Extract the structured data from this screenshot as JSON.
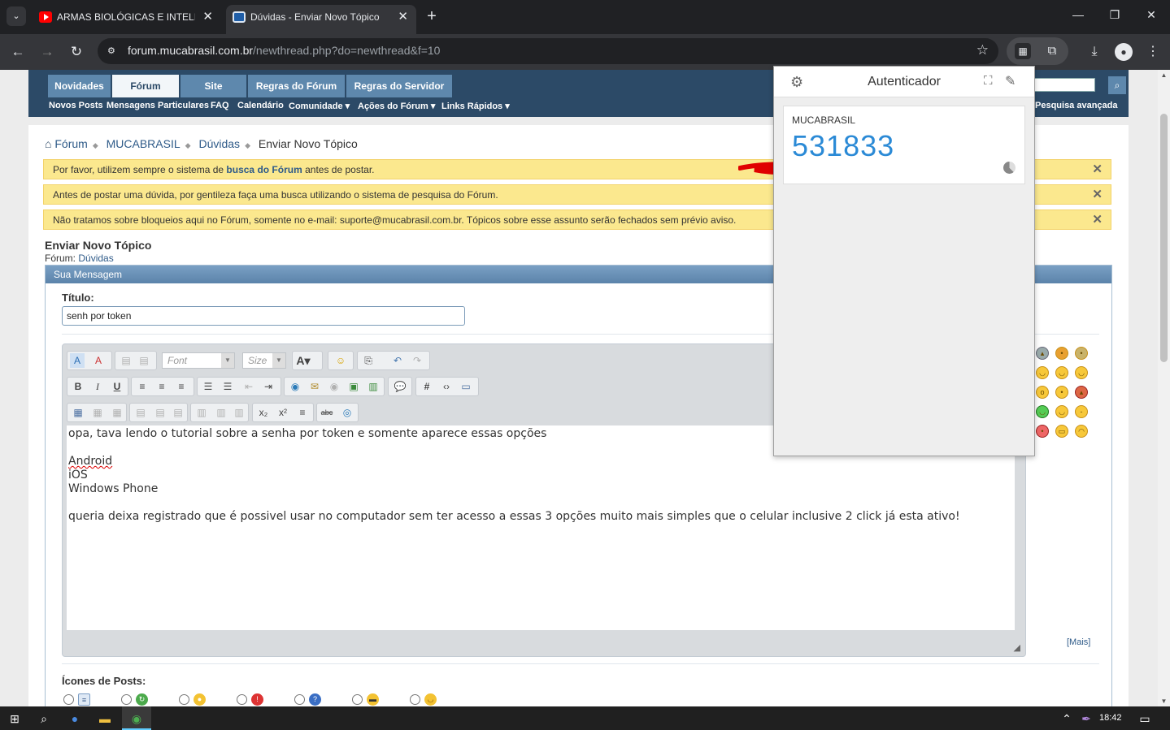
{
  "browser": {
    "tabs": [
      {
        "title": "ARMAS BIOLÓGICAS E INTELIGÊNCIA",
        "active": false,
        "favicon": "youtube-icon"
      },
      {
        "title": "Dúvidas - Enviar Novo Tópico",
        "active": true,
        "favicon": "mucabrasil-icon"
      }
    ],
    "url_host": "forum.mucabrasil.com.br",
    "url_path": "/newthread.php?do=newthread&f=10"
  },
  "forum": {
    "nav_tabs": [
      "Novidades",
      "Fórum",
      "Site",
      "Regras do Fórum",
      "Regras do Servidor"
    ],
    "active_tab": "Fórum",
    "subnav": [
      "Novos Posts",
      "Mensagens Particulares",
      "FAQ",
      "Calendário",
      "Comunidade ▾",
      "Ações do Fórum ▾",
      "Links Rápidos ▾"
    ],
    "advanced_search": "Pesquisa avançada",
    "breadcrumb": [
      "Fórum",
      "MUCABRASIL",
      "Dúvidas",
      "Enviar Novo Tópico"
    ],
    "notices": [
      {
        "pre": "Por favor, utilizem sempre o sistema de ",
        "link": "busca do Fórum",
        "post": " antes de postar."
      },
      {
        "pre": "Antes de postar uma dúvida, por gentileza faça uma busca utilizando o sistema de pesquisa do Fórum.",
        "link": "",
        "post": ""
      },
      {
        "pre": "Não tratamos sobre bloqueios aqui no Fórum, somente no e-mail: suporte@mucabrasil.com.br. Tópicos sobre esse assunto serão fechados sem prévio aviso.",
        "link": "",
        "post": ""
      }
    ],
    "page_title": "Enviar Novo Tópico",
    "forum_label": "Fórum:",
    "forum_name": "Dúvidas",
    "box_header": "Sua Mensagem",
    "title_label": "Título:",
    "title_value": "senh por token",
    "editor": {
      "font_placeholder": "Font",
      "size_placeholder": "Size",
      "lines": [
        "opa, tava lendo o tutorial sobre a senha por token e somente aparece essas opções",
        "",
        "Android",
        "iOS",
        "Windows Phone",
        "",
        "queria deixa registrado que é possivel usar no computador sem ter acesso a essas 3 opções muito mais simples que o celular inclusive 2 click já esta ativo!"
      ]
    },
    "more_smilies": "[Mais]",
    "post_icons_label": "Ícones de Posts:"
  },
  "authenticator": {
    "title": "Autenticador",
    "issuer": "MUCABRASIL",
    "code": "531833"
  },
  "taskbar": {
    "time": "18:42"
  },
  "colors": {
    "nav": "#2c4a67",
    "notice": "#fbe88e",
    "code": "#2b8ad6",
    "link": "#2f5b89"
  }
}
